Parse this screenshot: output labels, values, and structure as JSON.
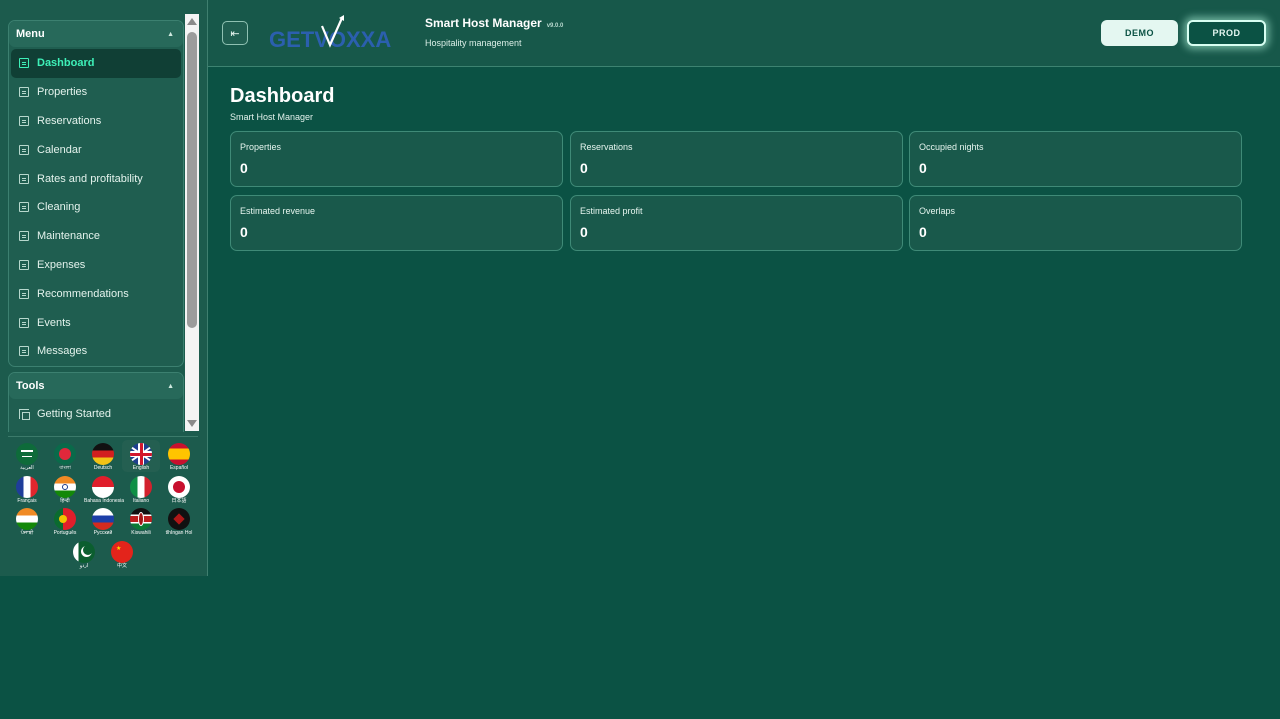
{
  "sidebar": {
    "menu_title": "Menu",
    "menu_items": [
      {
        "label": "Dashboard"
      },
      {
        "label": "Properties"
      },
      {
        "label": "Reservations"
      },
      {
        "label": "Calendar"
      },
      {
        "label": "Rates and profitability"
      },
      {
        "label": "Cleaning"
      },
      {
        "label": "Maintenance"
      },
      {
        "label": "Expenses"
      },
      {
        "label": "Recommendations"
      },
      {
        "label": "Events"
      },
      {
        "label": "Messages"
      }
    ],
    "tools_title": "Tools",
    "tools_items": [
      {
        "label": "Getting Started"
      }
    ],
    "languages": [
      {
        "label": "العربية"
      },
      {
        "label": "বাংলা"
      },
      {
        "label": "Deutsch"
      },
      {
        "label": "English"
      },
      {
        "label": "Español"
      },
      {
        "label": "Français"
      },
      {
        "label": "हिन्दी"
      },
      {
        "label": "Bahasa Indonesia"
      },
      {
        "label": "Italiano"
      },
      {
        "label": "日本語"
      },
      {
        "label": "ਪੰਜਾਬੀ"
      },
      {
        "label": "Português"
      },
      {
        "label": "Русский"
      },
      {
        "label": "Kiswahili"
      },
      {
        "label": "tlhIngan Hol"
      },
      {
        "label": "اردو"
      },
      {
        "label": "中文"
      }
    ],
    "selected_language": "English"
  },
  "header": {
    "logo_text": "GETVOXXA",
    "app_title": "Smart Host Manager",
    "version": "v9.0.0",
    "subtitle": "Hospitality management",
    "demo_label": "DEMO",
    "prod_label": "PROD",
    "active_env": "PROD"
  },
  "main": {
    "title": "Dashboard",
    "subtitle": "Smart Host Manager",
    "cards": [
      {
        "label": "Properties",
        "value": "0"
      },
      {
        "label": "Reservations",
        "value": "0"
      },
      {
        "label": "Occupied nights",
        "value": "0"
      },
      {
        "label": "Estimated revenue",
        "value": "0"
      },
      {
        "label": "Estimated profit",
        "value": "0"
      },
      {
        "label": "Overlaps",
        "value": "0"
      }
    ]
  },
  "colors": {
    "background": "#0b5244",
    "sidebar": "#1c5b4d",
    "accent": "#3ef0b8",
    "card_border": "#3f8a77"
  }
}
